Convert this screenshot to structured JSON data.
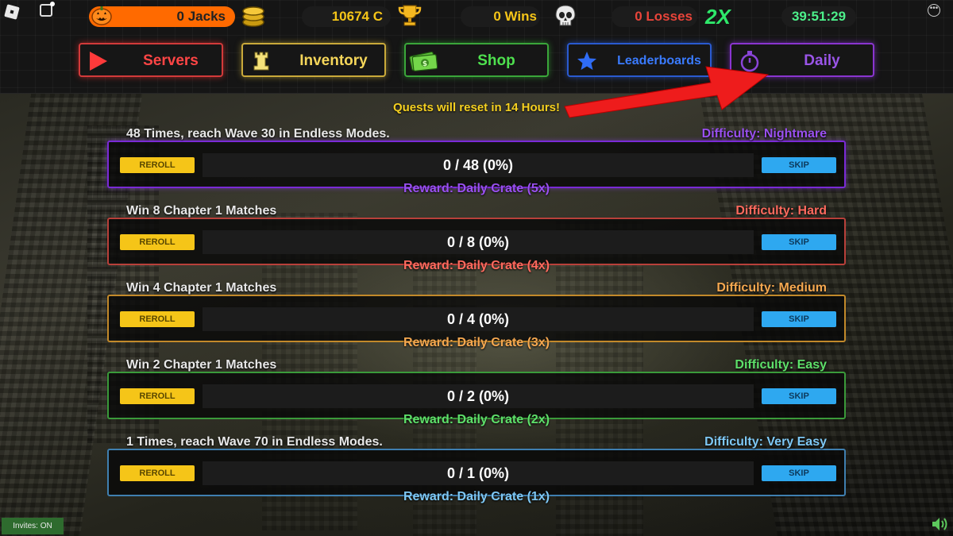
{
  "top_bar": {
    "jacks": "0 Jacks",
    "coins": "10674 C",
    "wins": "0 Wins",
    "losses": "0 Losses",
    "multiplier": "2X",
    "timer": "39:51:29"
  },
  "nav": {
    "servers": "Servers",
    "inventory": "Inventory",
    "shop": "Shop",
    "leaderboards": "Leaderboards",
    "daily": "Daily",
    "active": "Daily"
  },
  "reset_notice": "Quests will reset in 14 Hours!",
  "buttons": {
    "reroll": "REROLL",
    "skip": "SKIP"
  },
  "quests": [
    {
      "title": "48 Times, reach Wave 30 in Endless Modes.",
      "difficulty": "Difficulty: Nightmare",
      "progress": "0 / 48 (0%)",
      "progress_fraction": 0,
      "reward": "Reward: Daily Crate (5x)",
      "color": "#9a50f0"
    },
    {
      "title": "Win 8 Chapter 1 Matches",
      "difficulty": "Difficulty: Hard",
      "progress": "0 / 8 (0%)",
      "progress_fraction": 0,
      "reward": "Reward: Daily Crate (4x)",
      "color": "#ff6a5e"
    },
    {
      "title": "Win 4 Chapter 1 Matches",
      "difficulty": "Difficulty: Medium",
      "progress": "0 / 4 (0%)",
      "progress_fraction": 0,
      "reward": "Reward: Daily Crate (3x)",
      "color": "#f5a850"
    },
    {
      "title": "Win 2 Chapter 1 Matches",
      "difficulty": "Difficulty: Easy",
      "progress": "0 / 2 (0%)",
      "progress_fraction": 0,
      "reward": "Reward: Daily Crate (2x)",
      "color": "#5ee06a"
    },
    {
      "title": "1 Times, reach Wave 70 in Endless Modes.",
      "difficulty": "Difficulty: Very Easy",
      "progress": "0 / 1 (0%)",
      "progress_fraction": 0,
      "reward": "Reward: Daily Crate (1x)",
      "color": "#7ec8f5"
    }
  ],
  "footer": {
    "invites": "Invites: ON"
  },
  "icons": [
    "roblox-logo-icon",
    "chat-icon",
    "menu-icon",
    "pumpkin-icon",
    "coins-icon",
    "trophy-icon",
    "skull-icon",
    "play-icon",
    "rook-icon",
    "cash-icon",
    "star-icon",
    "stopwatch-icon",
    "volume-icon"
  ]
}
